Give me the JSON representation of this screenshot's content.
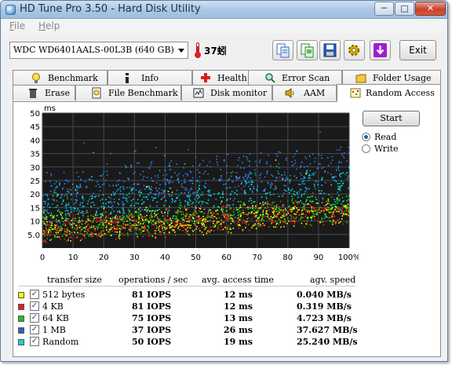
{
  "window": {
    "title": "HD Tune Pro 3.50 - Hard Disk Utility",
    "controls": {
      "minimize": "─",
      "maximize": "□",
      "close": "✕"
    }
  },
  "menu": {
    "file": "File",
    "help": "Help"
  },
  "toolbar": {
    "drive": "WDC WD6401AALS-00L3B (640 GB)",
    "temperature": "37蚓",
    "exit_label": "Exit"
  },
  "tabs": {
    "row1": [
      "Benchmark",
      "Info",
      "Health",
      "Error Scan",
      "Folder Usage"
    ],
    "row2": [
      "Erase",
      "File Benchmark",
      "Disk monitor",
      "AAM",
      "Random Access"
    ],
    "active": "Random Access"
  },
  "controls": {
    "start_label": "Start",
    "read_label": "Read",
    "write_label": "Write",
    "selected_mode": "Read"
  },
  "chart_data": {
    "type": "scatter",
    "ylabel": "ms",
    "ylim": [
      0,
      50
    ],
    "y_ticks": [
      "50",
      "45",
      "40",
      "35",
      "30",
      "25",
      "20",
      "15",
      "10",
      "5.0"
    ],
    "x_ticks": [
      "0",
      "10",
      "20",
      "30",
      "40",
      "50",
      "60",
      "70",
      "80",
      "90",
      "100%"
    ],
    "xlim": [
      0,
      100
    ],
    "grid": true,
    "background": "#1a1a1a",
    "series": [
      {
        "name": "512 bytes",
        "color": "#ffff00",
        "trend_ms": [
          7,
          14
        ],
        "spread_ms": 6
      },
      {
        "name": "4 KB",
        "color": "#ff2020",
        "trend_ms": [
          7,
          14
        ],
        "spread_ms": 6
      },
      {
        "name": "64 KB",
        "color": "#00e000",
        "trend_ms": [
          8,
          15
        ],
        "spread_ms": 6
      },
      {
        "name": "1 MB",
        "color": "#2a7fff",
        "trend_ms": [
          20,
          30
        ],
        "spread_ms": 10
      },
      {
        "name": "Random",
        "color": "#00e0e0",
        "trend_ms": [
          14,
          22
        ],
        "spread_ms": 10
      }
    ]
  },
  "results": {
    "headers": [
      "transfer size",
      "operations / sec",
      "avg. access time",
      "agv. speed"
    ],
    "rows": [
      {
        "size": "512 bytes",
        "color": "#ffff00",
        "checked": "✓",
        "ops": "81 IOPS",
        "access": "12 ms",
        "speed": "0.040 MB/s"
      },
      {
        "size": "4 KB",
        "color": "#e02020",
        "checked": "✓",
        "ops": "81 IOPS",
        "access": "12 ms",
        "speed": "0.319 MB/s"
      },
      {
        "size": "64 KB",
        "color": "#20c020",
        "checked": "✓",
        "ops": "75 IOPS",
        "access": "13 ms",
        "speed": "4.723 MB/s"
      },
      {
        "size": "1 MB",
        "color": "#2a5fd0",
        "checked": "✓",
        "ops": "37 IOPS",
        "access": "26 ms",
        "speed": "37.627 MB/s"
      },
      {
        "size": "Random",
        "color": "#20d0d0",
        "checked": "✓",
        "ops": "50 IOPS",
        "access": "19 ms",
        "speed": "25.240 MB/s"
      }
    ]
  }
}
